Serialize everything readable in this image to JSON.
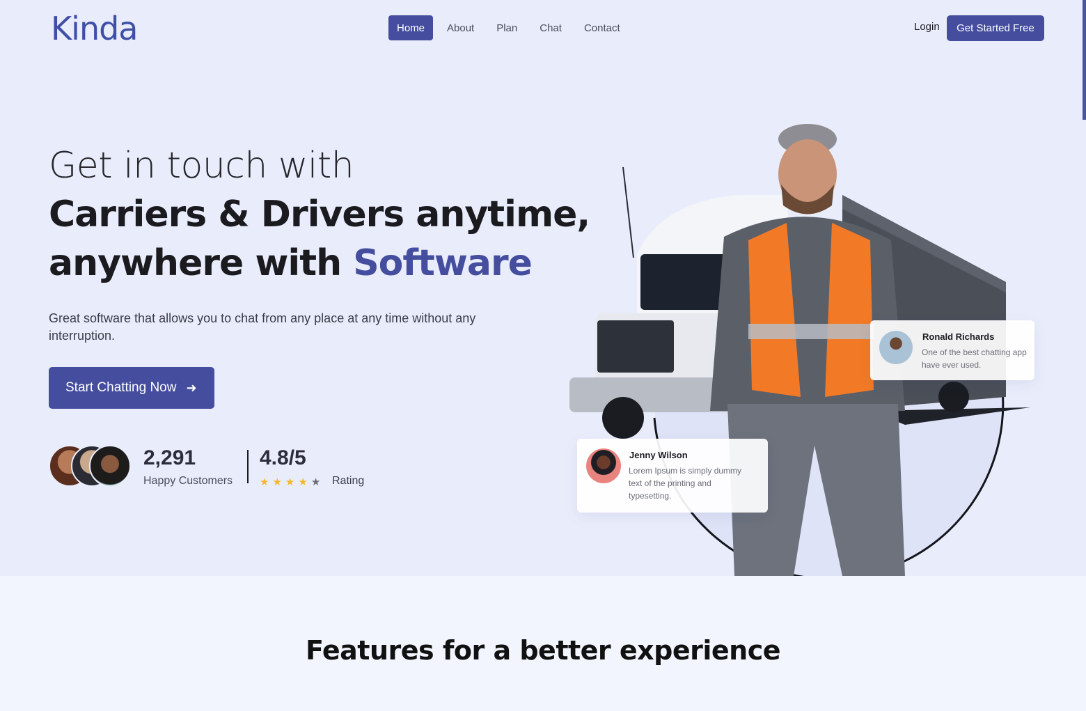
{
  "brand": {
    "logo": "Kinda",
    "accent_color": "#444d9e"
  },
  "nav": {
    "items": [
      {
        "label": "Home",
        "active": true
      },
      {
        "label": "About"
      },
      {
        "label": "Plan"
      },
      {
        "label": "Chat"
      },
      {
        "label": "Contact"
      }
    ],
    "login_label": "Login",
    "cta_label": "Get Started Free"
  },
  "hero": {
    "line1": "Get in touch with",
    "line2": "Carriers & Drivers anytime,",
    "line3_prefix": "anywhere with",
    "line3_accent": "Software",
    "lead": "Great software that allows you to chat from any place at any time without any interruption.",
    "cta_label": "Start Chatting Now",
    "cta_icon": "arrow-right-icon",
    "customers": {
      "count": "2,291",
      "label": "Happy Customers"
    },
    "rating": {
      "value": "4.8/5",
      "label": "Rating",
      "stars_filled": 4,
      "stars_total": 5
    }
  },
  "testimonials": [
    {
      "name": "Ronald Richards",
      "text": "One of the best chatting app have ever used."
    },
    {
      "name": "Jenny Wilson",
      "text": "Lorem Ipsum is simply dummy text of the printing and typesetting."
    }
  ],
  "features": {
    "title": "Features for a better experience"
  }
}
